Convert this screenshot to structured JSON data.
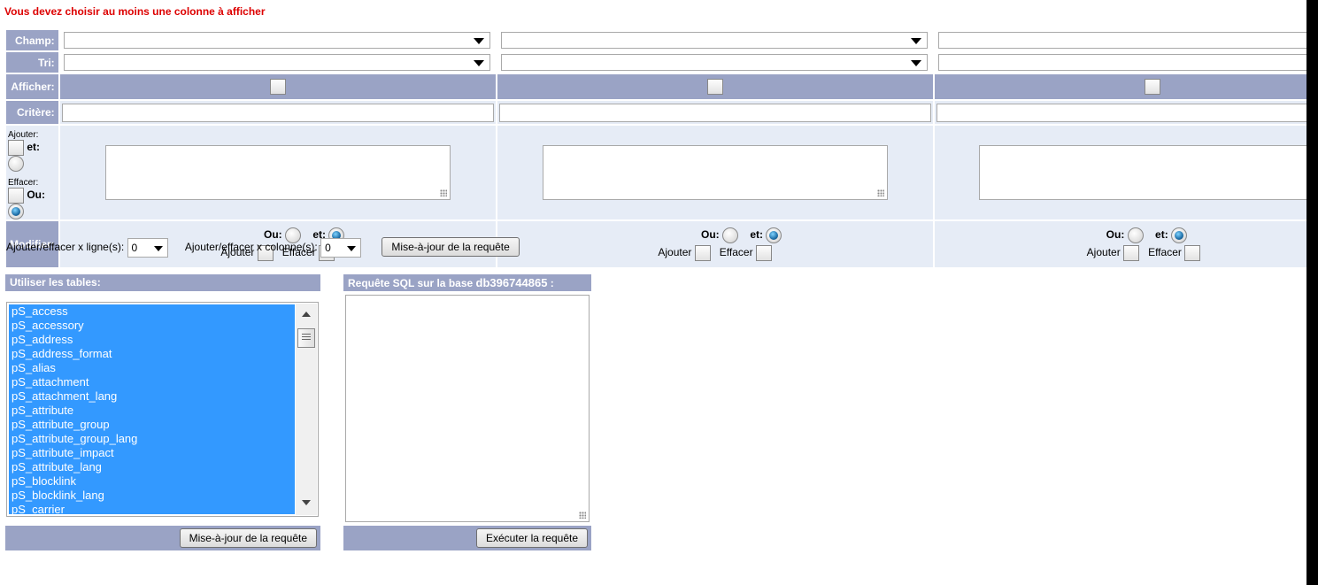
{
  "error_message": "Vous devez choisir au moins une colonne à afficher",
  "rows": {
    "champ": "Champ:",
    "tri": "Tri:",
    "afficher": "Afficher:",
    "critere": "Critère:",
    "modifier": "Modifier:"
  },
  "left_controls": {
    "ajouter": "Ajouter:",
    "effacer": "Effacer:",
    "et": "et:",
    "ou": "Ou:"
  },
  "modifier_controls": {
    "ou": "Ou:",
    "et": "et:",
    "ajouter": "Ajouter",
    "effacer": "Effacer"
  },
  "line_controls": {
    "rows_label": "Ajouter/effacer x ligne(s):",
    "rows_value": "0",
    "cols_label": "Ajouter/effacer x colonne(s):",
    "cols_value": "0",
    "update_button": "Mise-à-jour de la requête"
  },
  "tables_panel": {
    "header": "Utiliser les tables:",
    "items": [
      "pS_access",
      "pS_accessory",
      "pS_address",
      "pS_address_format",
      "pS_alias",
      "pS_attachment",
      "pS_attachment_lang",
      "pS_attribute",
      "pS_attribute_group",
      "pS_attribute_group_lang",
      "pS_attribute_impact",
      "pS_attribute_lang",
      "pS_blocklink",
      "pS_blocklink_lang",
      "pS_carrier"
    ],
    "update_button": "Mise-à-jour de la requête"
  },
  "sql_panel": {
    "header_prefix": "Requête SQL sur la base ",
    "database": "db396744865",
    "header_suffix": " :",
    "execute_button": "Exécuter la requête"
  }
}
